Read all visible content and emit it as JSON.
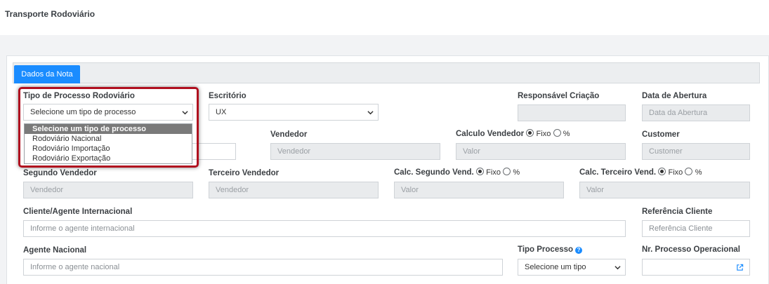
{
  "header": {
    "title": "Transporte Rodoviário"
  },
  "tabs": [
    {
      "label": "Dados da Nota"
    }
  ],
  "form": {
    "tipo_processo_rodoviario": {
      "label": "Tipo de Processo Rodoviário",
      "value": "Selecione um tipo de processo",
      "options": [
        "Selecione um tipo de processo",
        "Rodoviário Nacional",
        "Rodoviário Importação",
        "Rodoviário Exportação"
      ]
    },
    "escritorio": {
      "label": "Escritório",
      "value": "UX"
    },
    "responsavel_criacao": {
      "label": "Responsável Criação",
      "value": ""
    },
    "data_abertura": {
      "label": "Data de Abertura",
      "placeholder": "Data da Abertura"
    },
    "vendedor": {
      "label": "Vendedor",
      "placeholder": "Vendedor"
    },
    "calculo_vendedor": {
      "label": "Calculo Vendedor",
      "opt_fixo": "Fixo",
      "opt_pct": "%",
      "placeholder": "Valor"
    },
    "customer": {
      "label": "Customer",
      "placeholder": "Customer"
    },
    "segundo_vendedor": {
      "label": "Segundo Vendedor",
      "placeholder": "Vendedor"
    },
    "terceiro_vendedor": {
      "label": "Terceiro Vendedor",
      "placeholder": "Vendedor"
    },
    "calc_segundo": {
      "label": "Calc. Segundo Vend.",
      "opt_fixo": "Fixo",
      "opt_pct": "%",
      "placeholder": "Valor"
    },
    "calc_terceiro": {
      "label": "Calc. Terceiro Vend.",
      "opt_fixo": "Fixo",
      "opt_pct": "%",
      "placeholder": "Valor"
    },
    "cliente_agente": {
      "label": "Cliente/Agente Internacional",
      "placeholder": "Informe o agente internacional"
    },
    "referencia_cliente": {
      "label": "Referência Cliente",
      "placeholder": "Referência Cliente"
    },
    "agente_nacional": {
      "label": "Agente Nacional",
      "placeholder": "Informe o agente nacional"
    },
    "tipo_processo": {
      "label": "Tipo Processo",
      "value": "Selecione um tipo"
    },
    "nr_processo": {
      "label": "Nr. Processo Operacional",
      "value": ""
    }
  }
}
